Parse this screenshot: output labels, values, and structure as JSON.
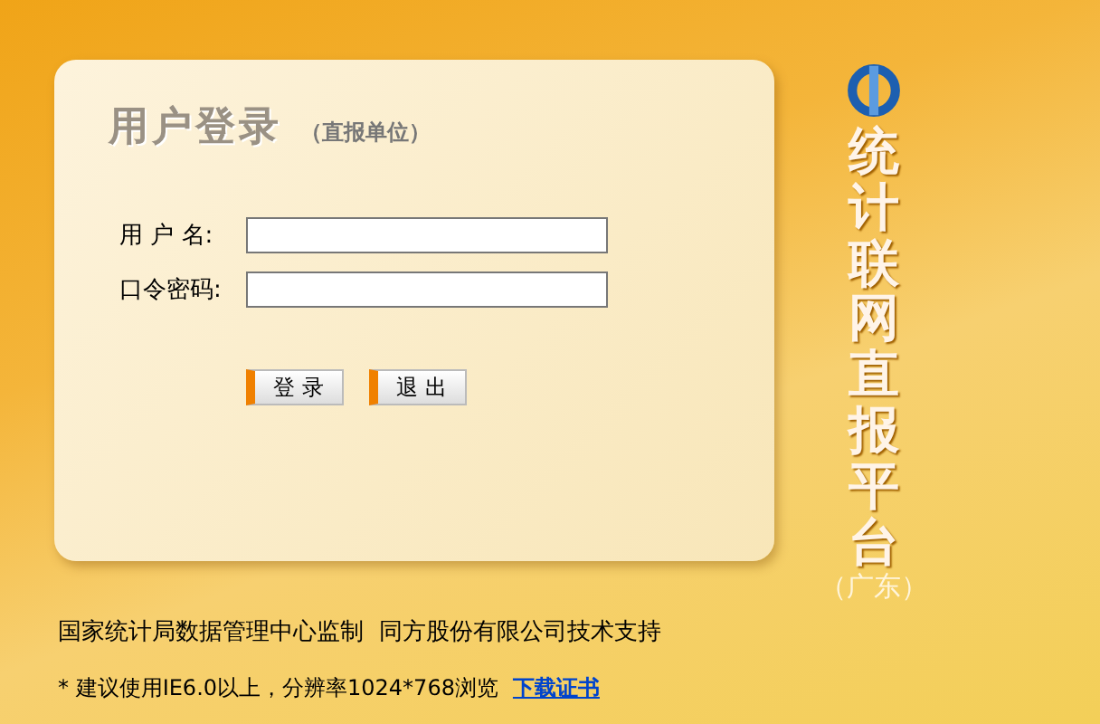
{
  "login": {
    "title": "用户登录",
    "subtitle": "（直报单位）",
    "fields": [
      {
        "label": "用 户 名:"
      },
      {
        "label": "口令密码:"
      }
    ],
    "buttons": [
      "登 录",
      "退 出"
    ]
  },
  "brand": {
    "title": "统计联网直报平台",
    "region": "（广东）"
  },
  "footer": {
    "credit": "国家统计局数据管理中心监制  同方股份有限公司技术支持",
    "hint": "* 建议使用IE6.0以上，分辨率1024*768浏览",
    "link": "下载证书"
  }
}
